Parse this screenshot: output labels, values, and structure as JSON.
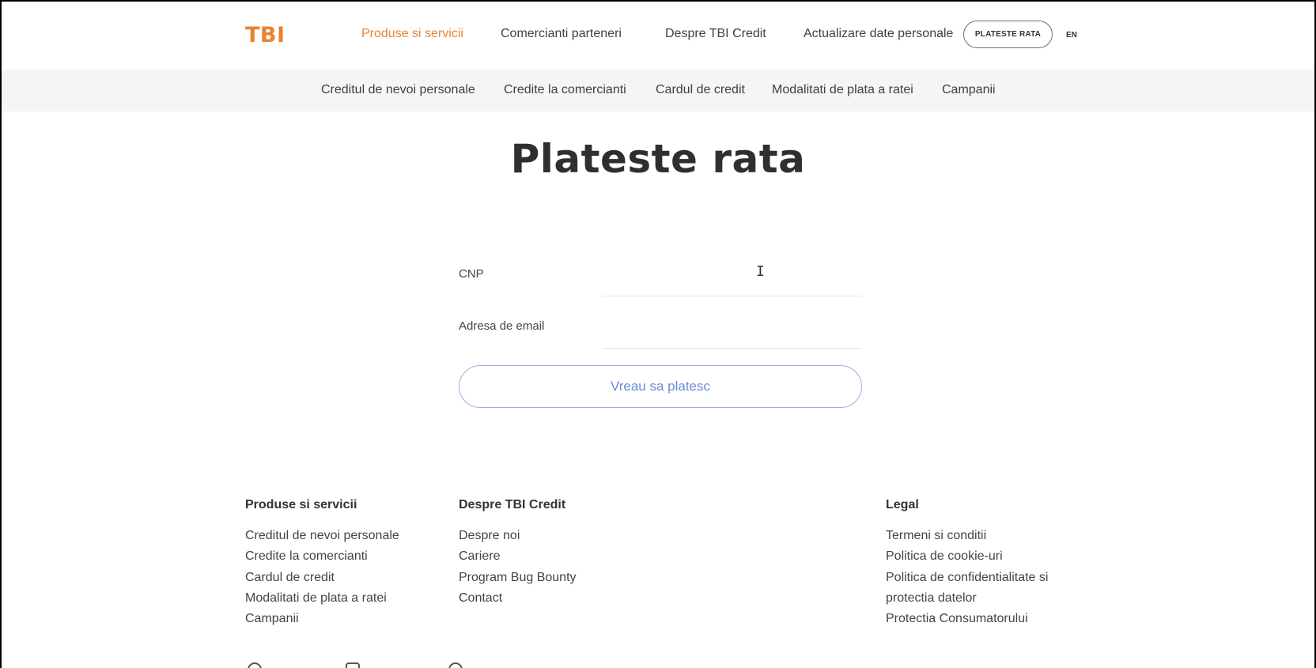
{
  "header": {
    "logo": "TBI",
    "nav": [
      {
        "label": "Produse si servicii",
        "active": true
      },
      {
        "label": "Comercianti parteneri"
      },
      {
        "label": "Despre TBI Credit"
      },
      {
        "label": "Actualizare date personale"
      }
    ],
    "pay_button": "PLATESTE RATA",
    "language": "EN"
  },
  "subnav": [
    "Creditul de nevoi personale",
    "Credite la comercianti",
    "Cardul de credit",
    "Modalitati de plata a ratei",
    "Campanii"
  ],
  "page_title": "Plateste rata",
  "form": {
    "cnp_label": "CNP",
    "cnp_value": "",
    "email_label": "Adresa de email",
    "email_value": "",
    "submit_label": "Vreau sa platesc"
  },
  "footer": {
    "products": {
      "heading": "Produse si servicii",
      "links": [
        "Creditul de nevoi personale",
        "Credite la comercianti",
        "Cardul de credit",
        "Modalitati de plata a ratei",
        "Campanii"
      ]
    },
    "about": {
      "heading": "Despre TBI Credit",
      "links": [
        "Despre noi",
        "Cariere",
        "Program Bug Bounty",
        "Contact"
      ]
    },
    "legal": {
      "heading": "Legal",
      "links": [
        "Termeni si conditii",
        "Politica de cookie-uri",
        "Politica de confidentialitate si",
        "protectia datelor",
        "Protectia Consumatorului"
      ]
    }
  },
  "colors": {
    "brand": "#e8822f",
    "button_border": "#9bb0e0",
    "button_text": "#6b8ad6",
    "subnav_bg": "#f5f5f5"
  },
  "icons": [
    "facebook-icon",
    "instagram-icon",
    "linkedin-icon"
  ]
}
